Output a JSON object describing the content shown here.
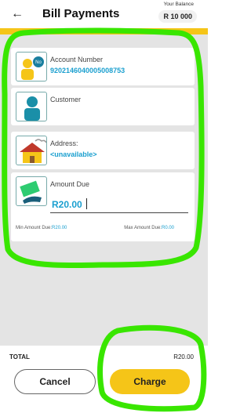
{
  "header": {
    "back_icon": "←",
    "title": "Bill Payments",
    "balance_label": "Your Balance",
    "balance_value": "R 10 000"
  },
  "cards": {
    "account": {
      "label": "Account Number",
      "value": "9202146040005008753",
      "icon": "person-id-icon"
    },
    "customer": {
      "label": "Customer",
      "icon": "person-icon"
    },
    "address": {
      "label": "Address:",
      "value": "<unavailable>",
      "icon": "house-icon"
    },
    "amount": {
      "label": "Amount Due",
      "value": "R20.00",
      "icon": "money-hand-icon",
      "min_label": "Min Amount Due:",
      "min_value": "R20.00",
      "max_label": "Max Amount Due:",
      "max_value": "R0.00"
    }
  },
  "footer": {
    "total_label": "TOTAL",
    "total_value": "R20.00",
    "cancel_label": "Cancel",
    "charge_label": "Charge"
  },
  "colors": {
    "accent_yellow": "#f5c518",
    "value_blue": "#1a9fcf",
    "highlight_green": "#39e600"
  }
}
